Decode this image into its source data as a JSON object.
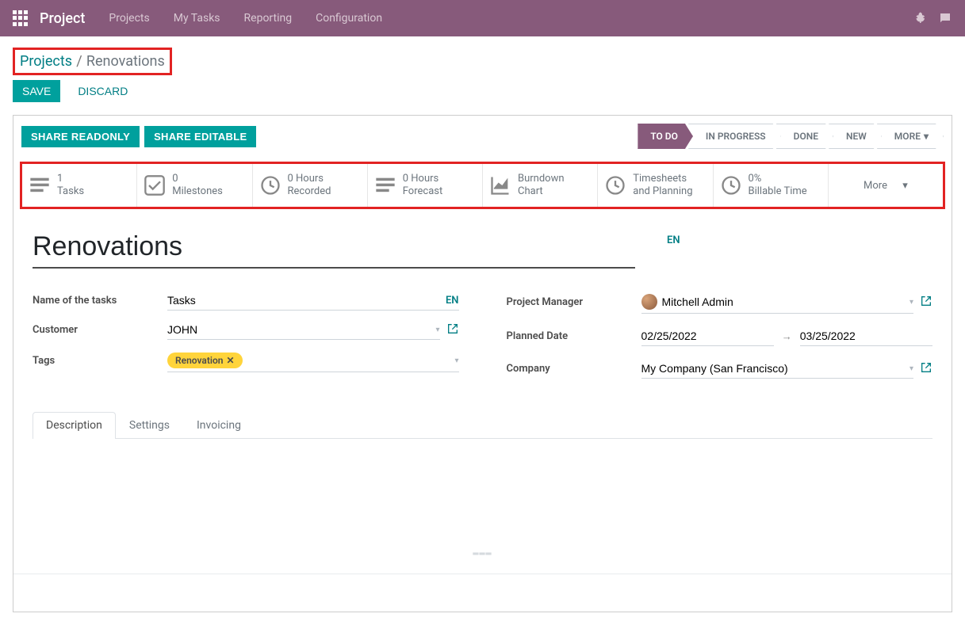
{
  "navbar": {
    "brand": "Project",
    "items": [
      "Projects",
      "My Tasks",
      "Reporting",
      "Configuration"
    ]
  },
  "breadcrumb": {
    "parent": "Projects",
    "current": "Renovations"
  },
  "buttons": {
    "save": "SAVE",
    "discard": "DISCARD",
    "share_readonly": "SHARE READONLY",
    "share_editable": "SHARE EDITABLE"
  },
  "status": {
    "steps": [
      "TO DO",
      "IN PROGRESS",
      "DONE",
      "NEW"
    ],
    "more": "MORE",
    "active_index": 0
  },
  "stats": {
    "tasks": {
      "value": "1",
      "label": "Tasks"
    },
    "milestones": {
      "value": "0",
      "label": "Milestones"
    },
    "recorded": {
      "value": "0 Hours",
      "label": "Recorded"
    },
    "forecast": {
      "value": "0 Hours",
      "label": "Forecast"
    },
    "burndown": {
      "value": "Burndown",
      "label": "Chart"
    },
    "timesheets": {
      "value": "Timesheets and Planning",
      "label": ""
    },
    "billable": {
      "value": "0%",
      "label": "Billable Time"
    },
    "more": "More"
  },
  "form": {
    "title": "Renovations",
    "en_badge": "EN",
    "labels": {
      "name_of_tasks": "Name of the tasks",
      "customer": "Customer",
      "tags": "Tags",
      "project_manager": "Project Manager",
      "planned_date": "Planned Date",
      "company": "Company"
    },
    "values": {
      "name_of_tasks": "Tasks",
      "customer": "JOHN",
      "tag": "Renovation",
      "project_manager": "Mitchell Admin",
      "date_start": "02/25/2022",
      "date_end": "03/25/2022",
      "company": "My Company (San Francisco)"
    }
  },
  "tabs": {
    "items": [
      "Description",
      "Settings",
      "Invoicing"
    ],
    "active_index": 0
  }
}
